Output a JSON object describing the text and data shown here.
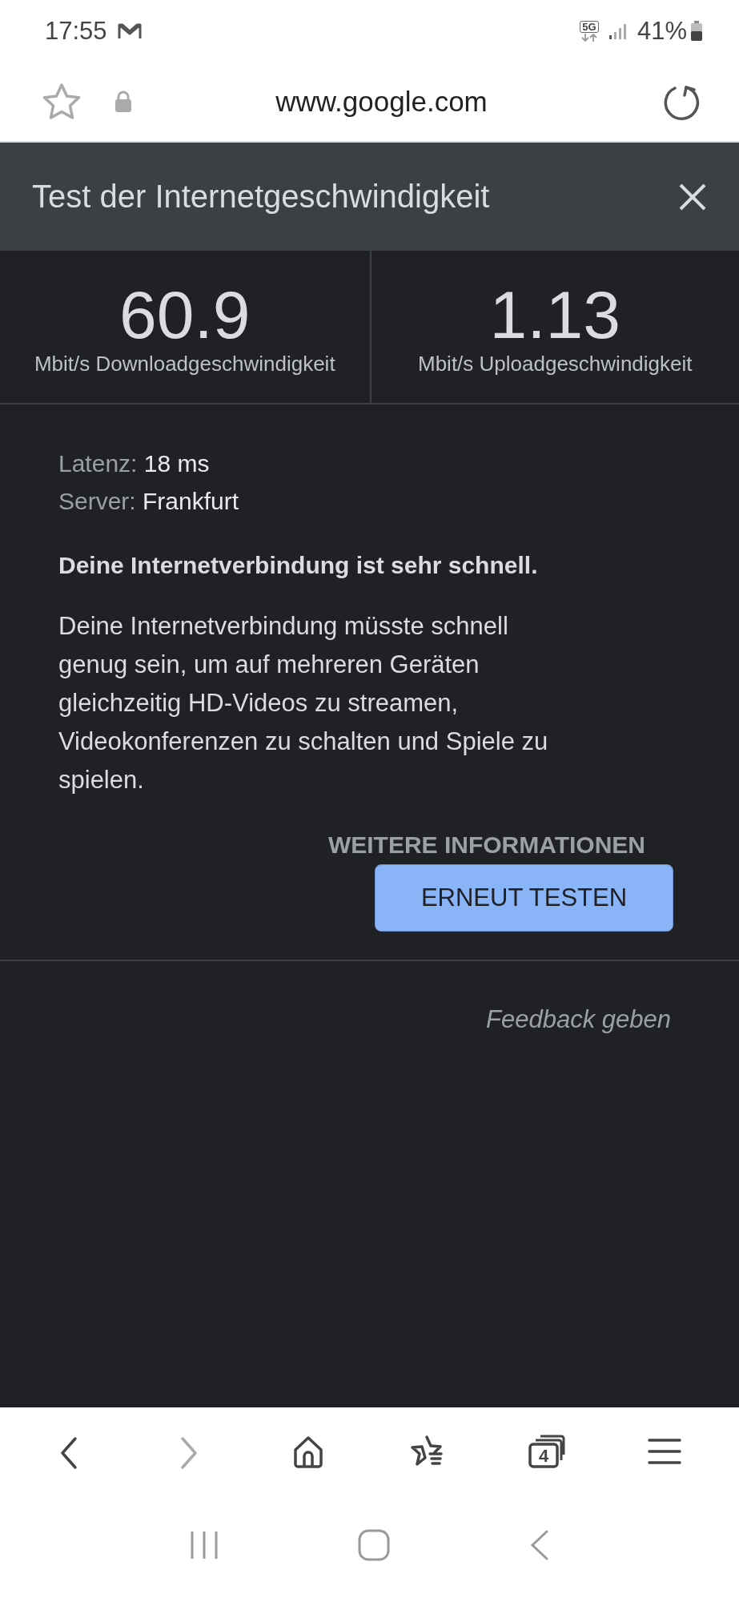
{
  "status_bar": {
    "time": "17:55",
    "network": "5G",
    "battery": "41%"
  },
  "address_bar": {
    "url": "www.google.com"
  },
  "speed_test": {
    "title": "Test der Internetgeschwindigkeit",
    "results": [
      {
        "value": "60.9",
        "label": "Mbit/s Downloadgeschwindigkeit"
      },
      {
        "value": "1.13",
        "label": "Mbit/s Uploadgeschwindigkeit"
      }
    ],
    "details": [
      {
        "label": "Latenz:",
        "value": "18 ms"
      },
      {
        "label": "Server:",
        "value": "Frankfurt"
      }
    ],
    "verdict": "Deine Internetverbindung ist sehr schnell.",
    "description": "Deine Internetverbindung müsste schnell genug sein, um auf mehreren Geräten gleichzeitig HD-Videos zu streamen, Videokonferenzen zu schalten und Spiele zu spielen.",
    "more_info_link": "WEITERE INFORMATIONEN",
    "retest_button": "ERNEUT TESTEN",
    "feedback_link": "Feedback geben"
  },
  "browser_nav": [
    {
      "kind": "back",
      "disabled": false
    },
    {
      "kind": "forward",
      "disabled": true
    },
    {
      "kind": "home",
      "disabled": false
    },
    {
      "kind": "bookmarks",
      "disabled": false
    },
    {
      "kind": "tabs",
      "disabled": false,
      "count": "4"
    },
    {
      "kind": "menu",
      "disabled": false
    }
  ]
}
